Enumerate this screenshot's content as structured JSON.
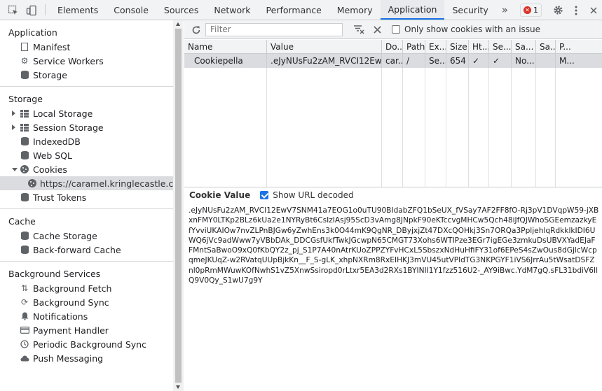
{
  "toolbar": {
    "tabs": [
      "Elements",
      "Console",
      "Sources",
      "Network",
      "Performance",
      "Memory",
      "Application",
      "Security"
    ],
    "active_tab": "Application",
    "error_count": "1"
  },
  "sidebar": {
    "application": {
      "title": "Application",
      "items": [
        "Manifest",
        "Service Workers",
        "Storage"
      ]
    },
    "storage": {
      "title": "Storage",
      "items": [
        "Local Storage",
        "Session Storage",
        "IndexedDB",
        "Web SQL",
        "Cookies"
      ],
      "cookie_origin": "https://caramel.kringlecastle.com",
      "trust_tokens": "Trust Tokens"
    },
    "cache": {
      "title": "Cache",
      "items": [
        "Cache Storage",
        "Back-forward Cache"
      ]
    },
    "background": {
      "title": "Background Services",
      "items": [
        "Background Fetch",
        "Background Sync",
        "Notifications",
        "Payment Handler",
        "Periodic Background Sync",
        "Push Messaging"
      ]
    }
  },
  "filterbar": {
    "placeholder": "Filter",
    "only_issue_label": "Only show cookies with an issue"
  },
  "table": {
    "columns": [
      "Name",
      "Value",
      "Do...",
      "Path",
      "Ex...",
      "Size",
      "Ht...",
      "Se...",
      "Sa...",
      "Sa...",
      "P..."
    ],
    "rows": [
      [
        "Cookiepella",
        ".eJyNUsFu2zAM_RVCI12Ew...",
        "car...",
        "/",
        "Se...",
        "654",
        "✓",
        "✓",
        "No...",
        "",
        "M..."
      ]
    ]
  },
  "cookie_value": {
    "title": "Cookie Value",
    "decode_label": "Show URL decoded",
    "decoded": true,
    "text": ".eJyNUsFu2zAM_RVCI12EwV7SNM41a7EOG1o0uTU90BIdabZFQ1bSeUX_fVSay7AF2FF8fO-Rj3pV1DVqpW59-jXBxnFMY0LTKp2BLz6kUa2e1NYRyBt6CsIzIAsj95ScD3vAmg8JNpkF90eKTccvgMHCw5Qch48iJfQJWhoSGEemzazkyEfYvviUKAIOw7nvZLPnBJGw6yZwhEns3k0O44mK9QgNR_DByjxjZt47DXcQOHkj3Sn7ORQa3PpljehlqRdkklkIDI6UWQ6jVc9adWww7yVBbDAk_DDCGsfUkfTwkJGcwpN65CMGT73Xohs6WTIPze3EGr7igEGe3zmkuDsUBVXYadEJaFFMntSaBwoO9xQ0fKbQY2z_pj_S1P7A40nAtrKUoZPPZYFvHCxL5SbszxNdHuHfiFY31of6EPeS4sZwOus8dGjlcWcpqmeJKUqZ-w2RVatqUUpBjkKn__F_S-gLK_xhpNXRm8RxEIHKJ3mVU45utVPldTG3NKPGYF1iVS6JrrAu5tWsatDSFZnl0pRmMWuwKOfNwhS1vZ5XnwSsiropd0rLtxr5EA3d2RXs1BYINII1Y1fzz516U2-_AY9iBwc.YdM7gQ.sFL31bdiV6IlQ9V0Qy_S1wU7g9Y"
  }
}
